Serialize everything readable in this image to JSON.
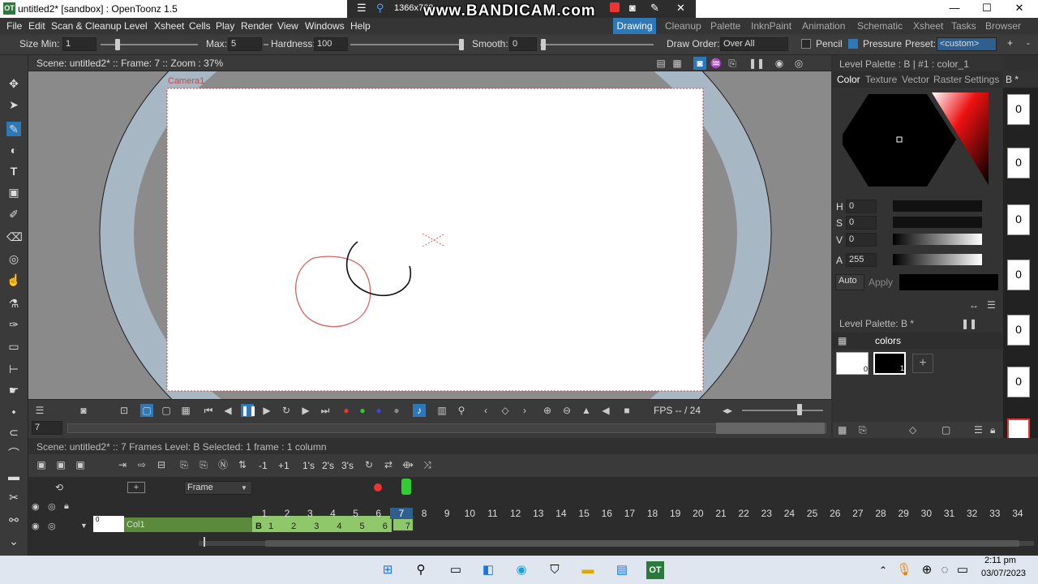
{
  "window": {
    "title": "untitled2* [sandbox] : OpenToonz 1.5",
    "app_icon": "OT",
    "minimize": "—",
    "maximize": "☐",
    "close": "✕"
  },
  "recorder": {
    "watermark": "www.BANDICAM.com",
    "resolution": "1366x768"
  },
  "menu": {
    "items": [
      "File",
      "Edit",
      "Scan & Cleanup",
      "Level",
      "Xsheet",
      "Cells",
      "Play",
      "Render",
      "View",
      "Windows",
      "Help"
    ],
    "rooms": [
      "Drawing",
      "Cleanup",
      "Palette",
      "InknPaint",
      "Animation",
      "Schematic",
      "Xsheet",
      "Tasks",
      "Browser"
    ]
  },
  "tool_options": {
    "size_min_label": "Size Min:",
    "size_min": "1",
    "max_label": "Max:",
    "max": "5",
    "hardness_label": "Hardness:",
    "hardness": "100",
    "smooth_label": "Smooth:",
    "smooth": "0",
    "draw_order_label": "Draw Order:",
    "draw_order": "Over All",
    "pencil_label": "Pencil",
    "pressure_label": "Pressure",
    "preset_label": "Preset:",
    "preset": "<custom>",
    "add": "+",
    "remove": "-"
  },
  "viewer": {
    "info": "Scene: untitled2*  ::  Frame: 7  ::  Zoom : 37%",
    "camera_label": "Camera1",
    "fps_label": "FPS -- / 24",
    "frame_field": "7"
  },
  "style_editor": {
    "header": "Level Palette : B | #1 : color_1",
    "tabs": [
      "Color",
      "Texture",
      "Vector",
      "Raster",
      "Settings"
    ],
    "channels": [
      {
        "name": "H",
        "value": "0"
      },
      {
        "name": "S",
        "value": "0"
      },
      {
        "name": "V",
        "value": "0"
      },
      {
        "name": "A",
        "value": "255"
      }
    ],
    "auto_label": "Auto",
    "apply_label": "Apply",
    "current_color": "#000000"
  },
  "level_palette": {
    "header": "Level Palette: B *",
    "page_tab": "colors",
    "styles": [
      {
        "index": "0"
      },
      {
        "index": "1"
      }
    ],
    "add": "+"
  },
  "level_strip": {
    "header": "B *",
    "frames": [
      "0",
      "0",
      "0",
      "0",
      "0",
      "0"
    ]
  },
  "xsheet": {
    "info": "Scene: untitled2*    ::    7 Frames  Level: B   Selected: 1 frame : 1 column",
    "frame_mode": "Frame",
    "frames": [
      "1",
      "2",
      "3",
      "4",
      "5",
      "6",
      "7",
      "8",
      "9",
      "10",
      "11",
      "12",
      "13",
      "14",
      "15",
      "16",
      "17",
      "18",
      "19",
      "20",
      "21",
      "22",
      "23",
      "24",
      "25",
      "26",
      "27",
      "28",
      "29",
      "30",
      "31",
      "32",
      "33",
      "34"
    ],
    "column": {
      "name": "Col1",
      "index": "0",
      "level": "B",
      "cells": [
        "1",
        "2",
        "3",
        "4",
        "5",
        "6",
        "7"
      ]
    },
    "step_buttons": [
      "-1",
      "+1",
      "1's",
      "2's",
      "3's"
    ]
  },
  "taskbar": {
    "time": "2:11 pm",
    "date": "03/07/2023"
  }
}
